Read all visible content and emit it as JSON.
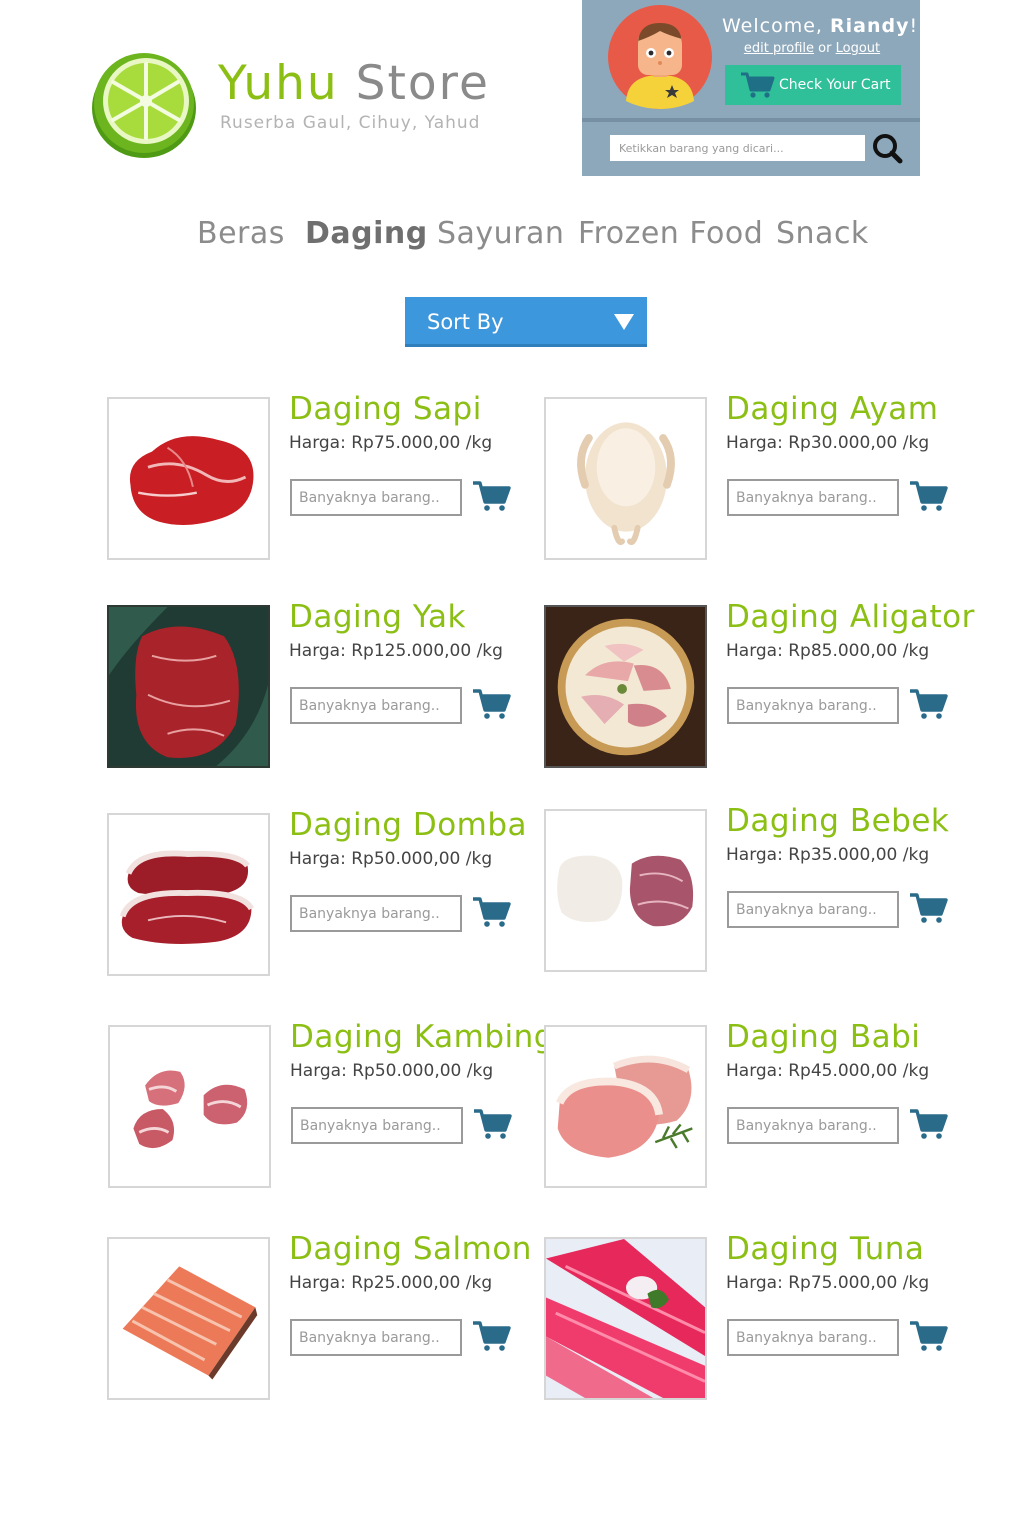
{
  "brand": {
    "name_part1": "Yuhu",
    "name_part2": "Store",
    "tagline": "Ruserba Gaul, Cihuy, Yahud",
    "logo_icon": "lime-slice-icon",
    "accent_color": "#8cbf14"
  },
  "user": {
    "welcome_prefix": "Welcome, ",
    "username": "Riandy",
    "welcome_suffix": "!",
    "edit_profile_label": "edit profile",
    "or_text": " or ",
    "logout_label": "Logout",
    "cart_button_label": "Check Your Cart",
    "panel_color": "#8ea8bb",
    "cart_button_color": "#2fc09a"
  },
  "search": {
    "placeholder": "Ketikkan barang yang dicari..."
  },
  "nav": {
    "items": [
      {
        "label": "Beras",
        "active": false
      },
      {
        "label": "Daging",
        "active": true
      },
      {
        "label": "Sayuran",
        "active": false
      },
      {
        "label": "Frozen Food",
        "active": false
      },
      {
        "label": "Snack",
        "active": false
      }
    ]
  },
  "sort": {
    "label": "Sort By",
    "color": "#3d97dd"
  },
  "products": {
    "qty_placeholder": "Banyaknya barang..",
    "items": [
      {
        "name": "Daging Sapi",
        "price": "Harga: Rp75.000,00 /kg",
        "image": "beef-steak-image"
      },
      {
        "name": "Daging Ayam",
        "price": "Harga: Rp30.000,00 /kg",
        "image": "whole-chicken-image"
      },
      {
        "name": "Daging Yak",
        "price": "Harga: Rp125.000,00 /kg",
        "image": "yak-meat-image"
      },
      {
        "name": "Daging Aligator",
        "price": "Harga: Rp85.000,00 /kg",
        "image": "alligator-plate-image"
      },
      {
        "name": "Daging Domba",
        "price": "Harga: Rp50.000,00 /kg",
        "image": "lamb-steak-image"
      },
      {
        "name": "Daging Bebek",
        "price": "Harga: Rp35.000,00 /kg",
        "image": "duck-meat-image"
      },
      {
        "name": "Daging Kambing",
        "price": "Harga: Rp50.000,00 /kg",
        "image": "goat-chunks-image"
      },
      {
        "name": "Daging Babi",
        "price": "Harga: Rp45.000,00 /kg",
        "image": "pork-chop-image"
      },
      {
        "name": "Daging Salmon",
        "price": "Harga: Rp25.000,00 /kg",
        "image": "salmon-fillet-image"
      },
      {
        "name": "Daging Tuna",
        "price": "Harga: Rp75.000,00 /kg",
        "image": "tuna-sashimi-image"
      }
    ]
  }
}
